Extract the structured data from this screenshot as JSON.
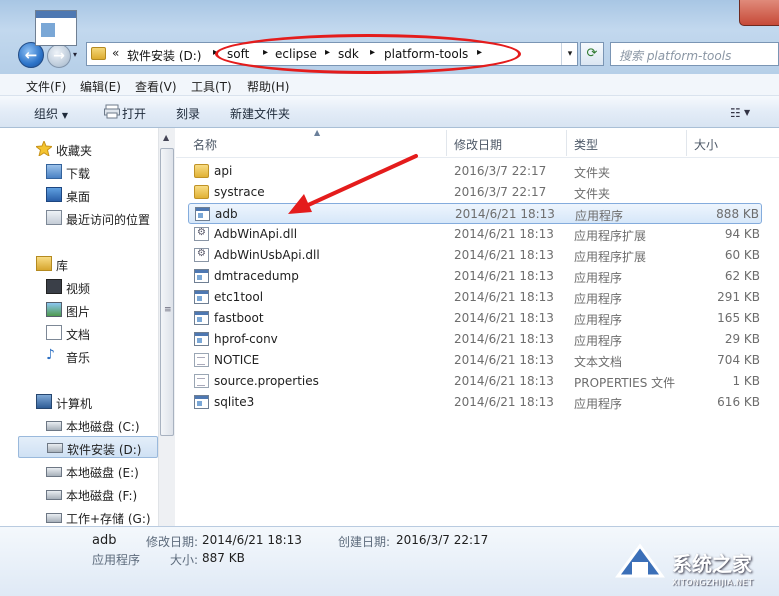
{
  "address": {
    "overflow": "«",
    "crumbs": [
      "软件安装 (D:)",
      "soft",
      "eclipse",
      "sdk",
      "platform-tools"
    ]
  },
  "search": {
    "placeholder": "搜索 platform-tools"
  },
  "menu": [
    "文件(F)",
    "编辑(E)",
    "查看(V)",
    "工具(T)",
    "帮助(H)"
  ],
  "toolbar": {
    "organize": "组织",
    "print": "打开",
    "burn": "刻录",
    "new_folder": "新建文件夹"
  },
  "nav": {
    "favorites": {
      "label": "收藏夹",
      "items": [
        "下载",
        "桌面",
        "最近访问的位置"
      ]
    },
    "libraries": {
      "label": "库",
      "items": [
        "视频",
        "图片",
        "文档",
        "音乐"
      ]
    },
    "computer": {
      "label": "计算机",
      "items": [
        "本地磁盘 (C:)",
        "软件安装 (D:)",
        "本地磁盘 (E:)",
        "本地磁盘 (F:)",
        "工作+存储 (G:)"
      ]
    }
  },
  "columns": {
    "name": "名称",
    "modified": "修改日期",
    "type": "类型",
    "size": "大小"
  },
  "files": [
    {
      "name": "api",
      "modified": "2016/3/7 22:17",
      "type": "文件夹",
      "size": "",
      "icon": "folder-icon"
    },
    {
      "name": "systrace",
      "modified": "2016/3/7 22:17",
      "type": "文件夹",
      "size": "",
      "icon": "folder-icon"
    },
    {
      "name": "adb",
      "modified": "2014/6/21 18:13",
      "type": "应用程序",
      "size": "888 KB",
      "icon": "application-icon"
    },
    {
      "name": "AdbWinApi.dll",
      "modified": "2014/6/21 18:13",
      "type": "应用程序扩展",
      "size": "94 KB",
      "icon": "dll-icon"
    },
    {
      "name": "AdbWinUsbApi.dll",
      "modified": "2014/6/21 18:13",
      "type": "应用程序扩展",
      "size": "60 KB",
      "icon": "dll-icon"
    },
    {
      "name": "dmtracedump",
      "modified": "2014/6/21 18:13",
      "type": "应用程序",
      "size": "62 KB",
      "icon": "application-icon"
    },
    {
      "name": "etc1tool",
      "modified": "2014/6/21 18:13",
      "type": "应用程序",
      "size": "291 KB",
      "icon": "application-icon"
    },
    {
      "name": "fastboot",
      "modified": "2014/6/21 18:13",
      "type": "应用程序",
      "size": "165 KB",
      "icon": "application-icon"
    },
    {
      "name": "hprof-conv",
      "modified": "2014/6/21 18:13",
      "type": "应用程序",
      "size": "29 KB",
      "icon": "application-icon"
    },
    {
      "name": "NOTICE",
      "modified": "2014/6/21 18:13",
      "type": "文本文档",
      "size": "704 KB",
      "icon": "document-icon"
    },
    {
      "name": "source.properties",
      "modified": "2014/6/21 18:13",
      "type": "PROPERTIES 文件",
      "size": "1 KB",
      "icon": "document-icon"
    },
    {
      "name": "sqlite3",
      "modified": "2014/6/21 18:13",
      "type": "应用程序",
      "size": "616 KB",
      "icon": "application-icon"
    }
  ],
  "details": {
    "name": "adb",
    "type": "应用程序",
    "modified_label": "修改日期:",
    "modified": "2014/6/21 18:13",
    "created_label": "创建日期:",
    "created": "2016/3/7 22:17",
    "size_label": "大小:",
    "size": "887 KB"
  },
  "watermark": {
    "text": "系统之家",
    "url": "XITONGZHIJIA.NET"
  },
  "colors": {
    "annotation": "#e41c1c",
    "selection": "#cfe1f4",
    "chrome": "#b6cfe8"
  }
}
